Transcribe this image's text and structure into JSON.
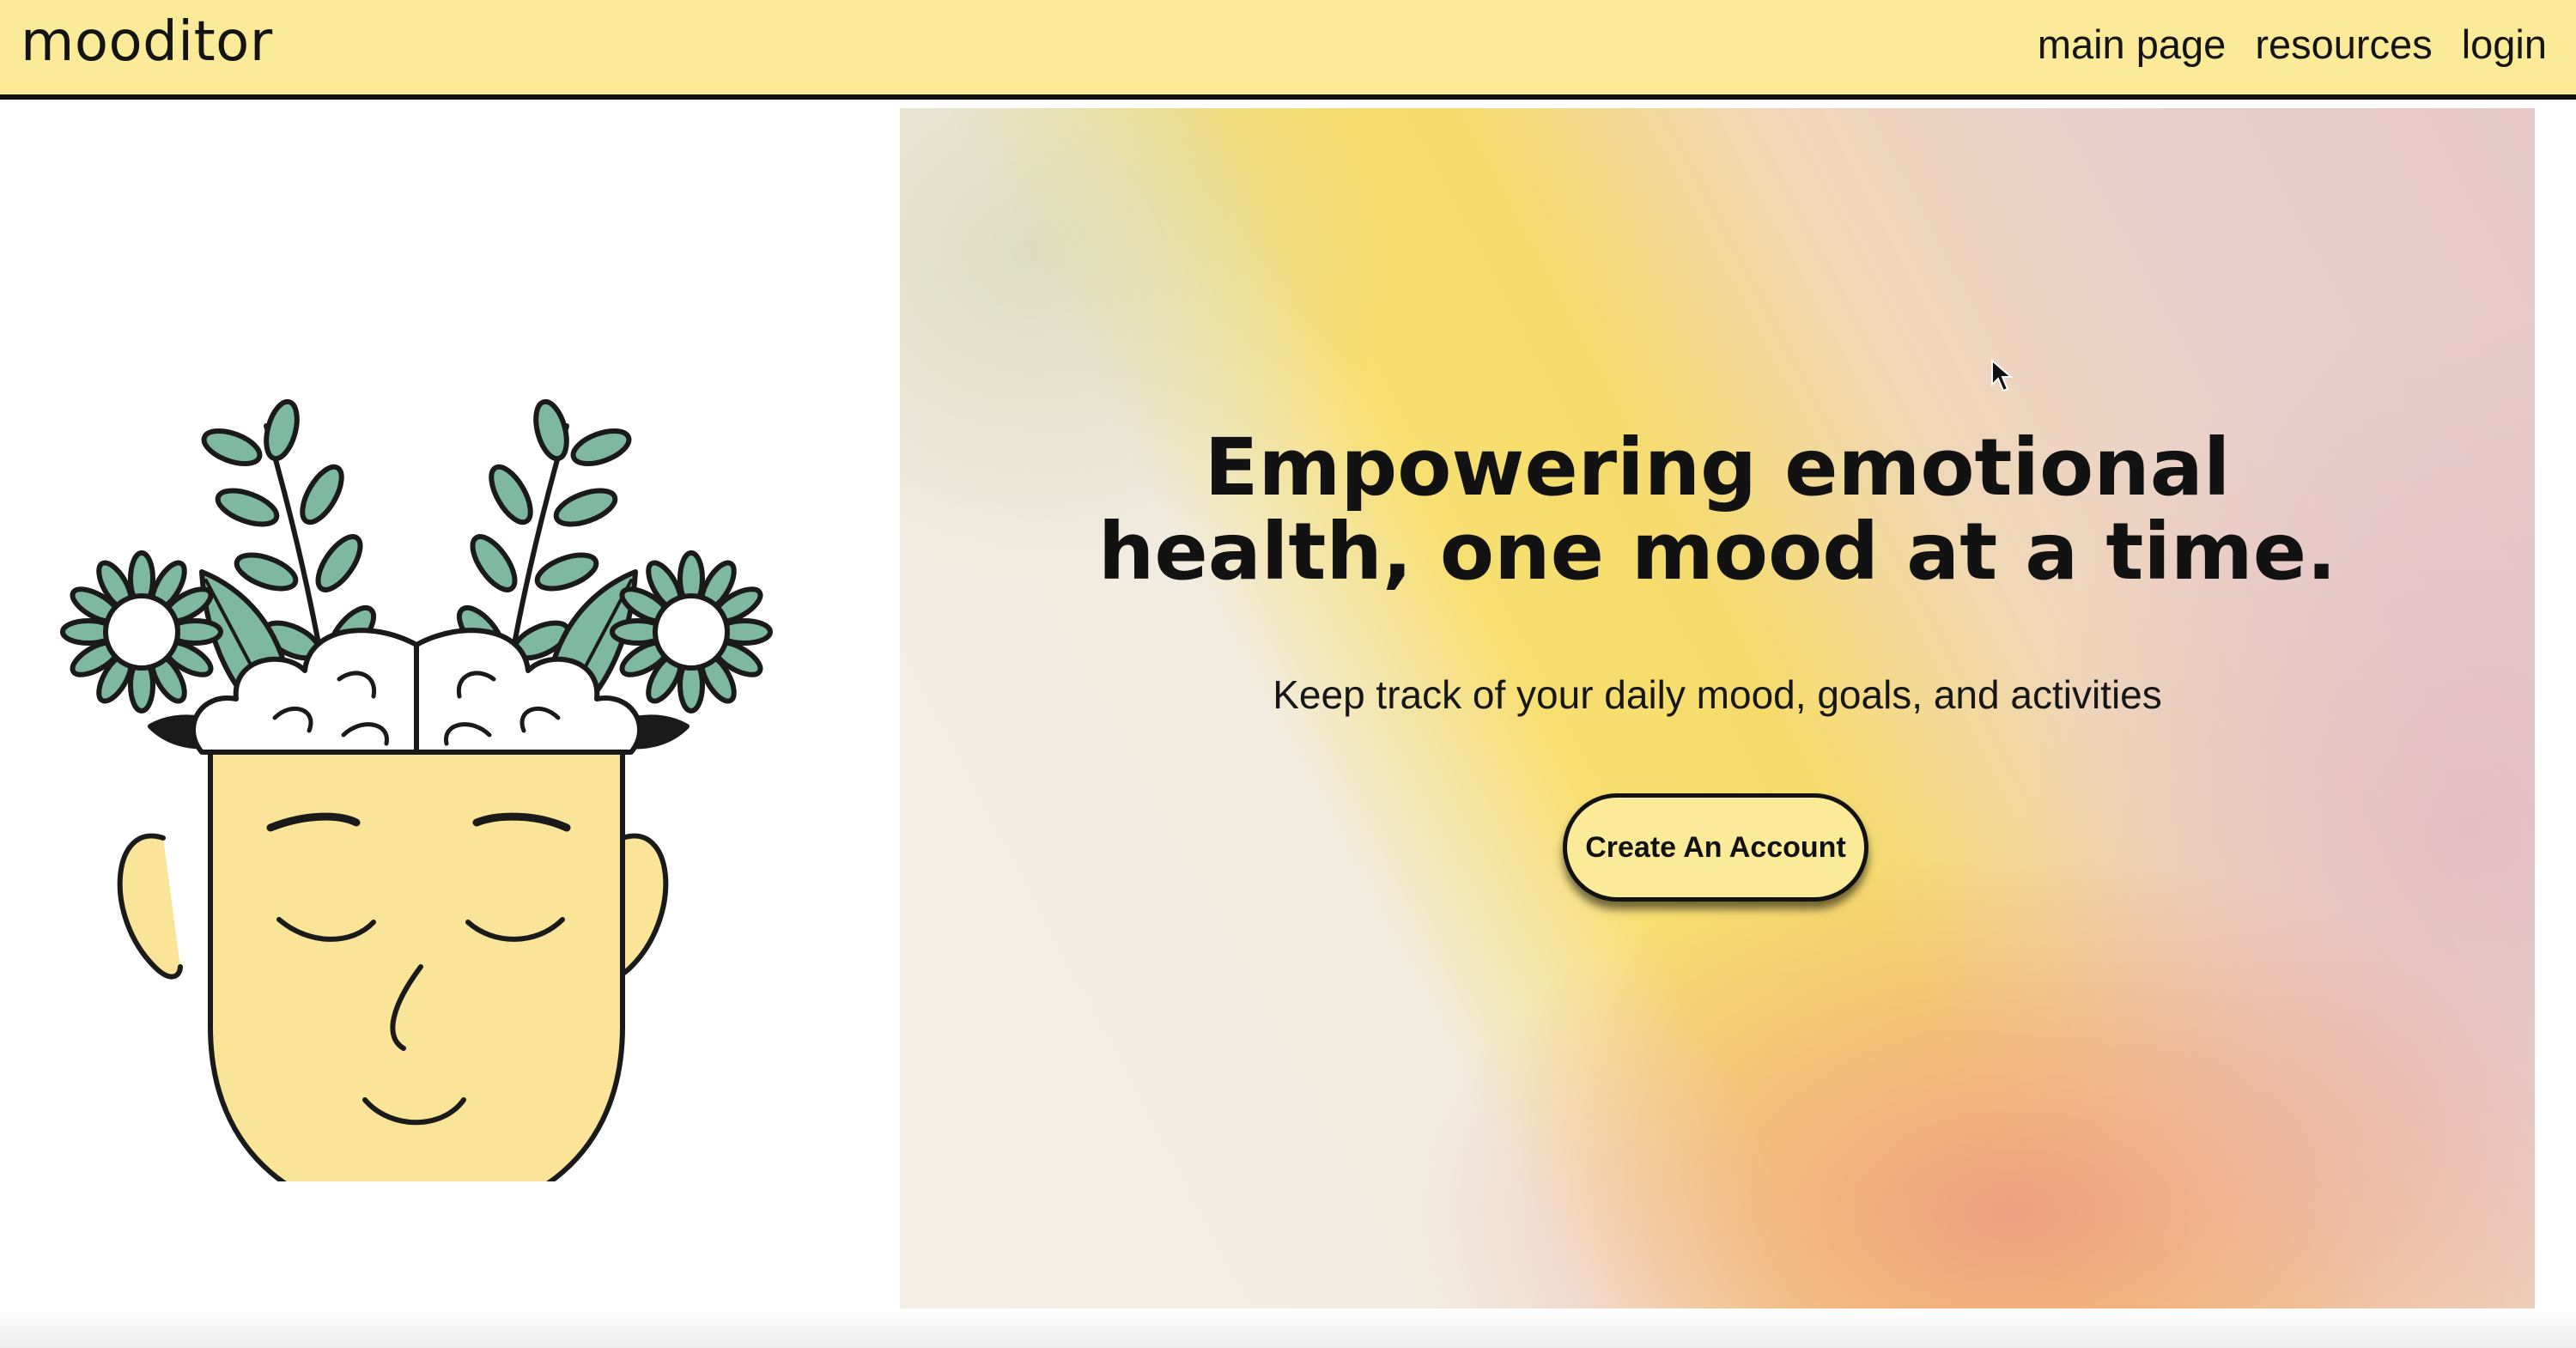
{
  "navbar": {
    "brand": "mooditor",
    "links": [
      "main page",
      "resources",
      "login"
    ]
  },
  "illustration": {
    "icon": "head-with-flowers-brain-icon",
    "colors": {
      "skin": "#f9e497",
      "leaf": "#7fb8a1",
      "outline": "#1a1a1a"
    }
  },
  "hero": {
    "title": "Empowering emotional\nhealth, one mood at a time.",
    "subtitle": "Keep track of your daily mood, goals, and activities",
    "cta_label": "Create An Account"
  },
  "colors": {
    "nav_bg": "#fbeb98",
    "button_bg": "#fbeb98",
    "text": "#141414"
  },
  "cursor_icon": "mouse-pointer-icon"
}
